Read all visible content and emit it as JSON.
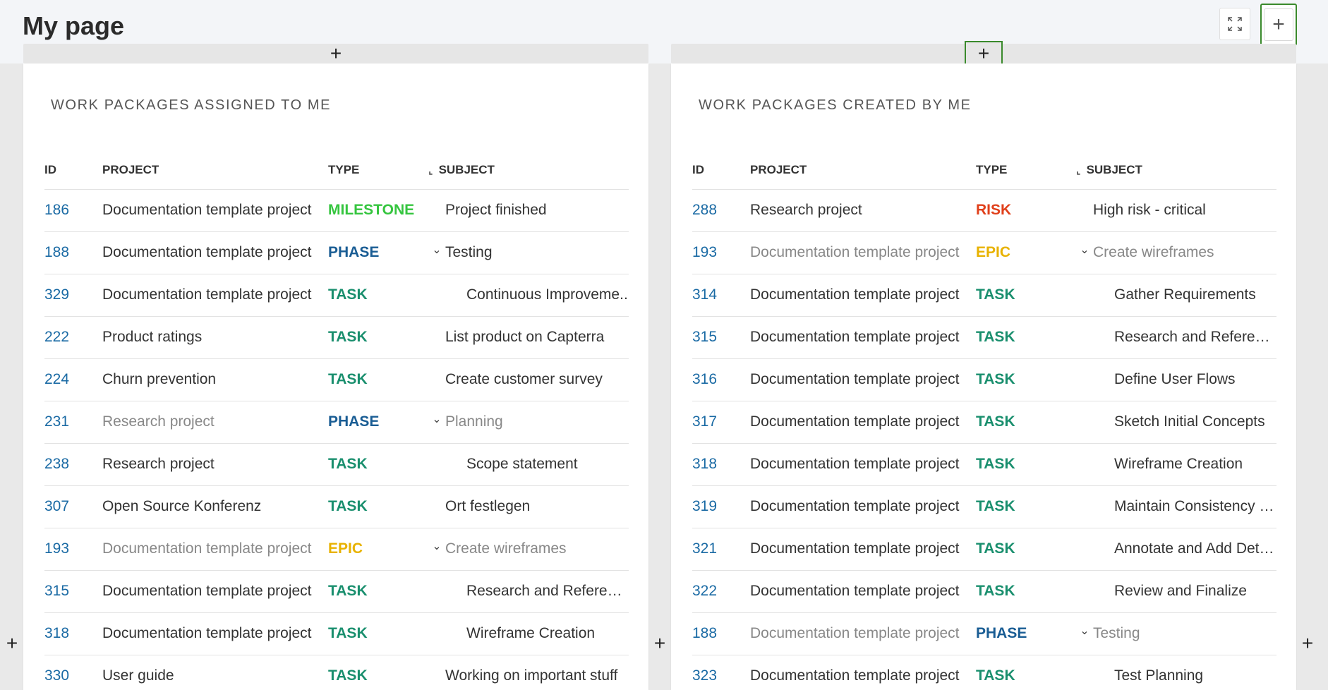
{
  "page": {
    "title": "My page"
  },
  "icons": {
    "fullscreen": "fullscreen-icon",
    "add": "+"
  },
  "widgets": [
    {
      "title": "WORK PACKAGES ASSIGNED TO ME",
      "columns": [
        "ID",
        "PROJECT",
        "TYPE",
        "SUBJECT"
      ],
      "rows": [
        {
          "id": "186",
          "project": "Documentation template project",
          "type": "MILESTONE",
          "subject": "Project finished",
          "level": 0,
          "collapsible": false,
          "muted": false
        },
        {
          "id": "188",
          "project": "Documentation template project",
          "type": "PHASE",
          "subject": "Testing",
          "level": 0,
          "collapsible": true,
          "muted": false
        },
        {
          "id": "329",
          "project": "Documentation template project",
          "type": "TASK",
          "subject": "Continuous Improveme..",
          "level": 1,
          "collapsible": false,
          "muted": false
        },
        {
          "id": "222",
          "project": "Product ratings",
          "type": "TASK",
          "subject": "List product on Capterra",
          "level": 0,
          "collapsible": false,
          "muted": false
        },
        {
          "id": "224",
          "project": "Churn prevention",
          "type": "TASK",
          "subject": "Create customer survey",
          "level": 0,
          "collapsible": false,
          "muted": false
        },
        {
          "id": "231",
          "project": "Research project",
          "type": "PHASE",
          "subject": "Planning",
          "level": 0,
          "collapsible": true,
          "muted": true
        },
        {
          "id": "238",
          "project": "Research project",
          "type": "TASK",
          "subject": "Scope statement",
          "level": 1,
          "collapsible": false,
          "muted": false
        },
        {
          "id": "307",
          "project": "Open Source Konferenz",
          "type": "TASK",
          "subject": "Ort festlegen",
          "level": 0,
          "collapsible": false,
          "muted": false
        },
        {
          "id": "193",
          "project": "Documentation template project",
          "type": "EPIC",
          "subject": "Create wireframes",
          "level": 0,
          "collapsible": true,
          "muted": true
        },
        {
          "id": "315",
          "project": "Documentation template project",
          "type": "TASK",
          "subject": "Research and Reference",
          "level": 1,
          "collapsible": false,
          "muted": false
        },
        {
          "id": "318",
          "project": "Documentation template project",
          "type": "TASK",
          "subject": "Wireframe Creation",
          "level": 1,
          "collapsible": false,
          "muted": false
        },
        {
          "id": "330",
          "project": "User guide",
          "type": "TASK",
          "subject": "Working on important stuff",
          "level": 0,
          "collapsible": false,
          "muted": false
        }
      ]
    },
    {
      "title": "WORK PACKAGES CREATED BY ME",
      "columns": [
        "ID",
        "PROJECT",
        "TYPE",
        "SUBJECT"
      ],
      "rows": [
        {
          "id": "288",
          "project": "Research project",
          "type": "RISK",
          "subject": "High risk - critical",
          "level": 0,
          "collapsible": false,
          "muted": false
        },
        {
          "id": "193",
          "project": "Documentation template project",
          "type": "EPIC",
          "subject": "Create wireframes",
          "level": 0,
          "collapsible": true,
          "muted": true
        },
        {
          "id": "314",
          "project": "Documentation template project",
          "type": "TASK",
          "subject": "Gather Requirements",
          "level": 1,
          "collapsible": false,
          "muted": false
        },
        {
          "id": "315",
          "project": "Documentation template project",
          "type": "TASK",
          "subject": "Research and Reference",
          "level": 1,
          "collapsible": false,
          "muted": false
        },
        {
          "id": "316",
          "project": "Documentation template project",
          "type": "TASK",
          "subject": "Define User Flows",
          "level": 1,
          "collapsible": false,
          "muted": false
        },
        {
          "id": "317",
          "project": "Documentation template project",
          "type": "TASK",
          "subject": "Sketch Initial Concepts",
          "level": 1,
          "collapsible": false,
          "muted": false
        },
        {
          "id": "318",
          "project": "Documentation template project",
          "type": "TASK",
          "subject": "Wireframe Creation",
          "level": 1,
          "collapsible": false,
          "muted": false
        },
        {
          "id": "319",
          "project": "Documentation template project",
          "type": "TASK",
          "subject": "Maintain Consistency and",
          "level": 1,
          "collapsible": false,
          "muted": false
        },
        {
          "id": "321",
          "project": "Documentation template project",
          "type": "TASK",
          "subject": "Annotate and Add Details",
          "level": 1,
          "collapsible": false,
          "muted": false
        },
        {
          "id": "322",
          "project": "Documentation template project",
          "type": "TASK",
          "subject": "Review and Finalize",
          "level": 1,
          "collapsible": false,
          "muted": false
        },
        {
          "id": "188",
          "project": "Documentation template project",
          "type": "PHASE",
          "subject": "Testing",
          "level": 0,
          "collapsible": true,
          "muted": true
        },
        {
          "id": "323",
          "project": "Documentation template project",
          "type": "TASK",
          "subject": "Test Planning",
          "level": 1,
          "collapsible": false,
          "muted": false
        }
      ]
    }
  ],
  "colors": {
    "link": "#1a6aa4",
    "MILESTONE": "#35c53f",
    "PHASE": "#1a5d94",
    "TASK": "#1a8f6e",
    "EPIC": "#e8b200",
    "RISK": "#e0401b",
    "highlight_border": "#3a8a2c"
  }
}
